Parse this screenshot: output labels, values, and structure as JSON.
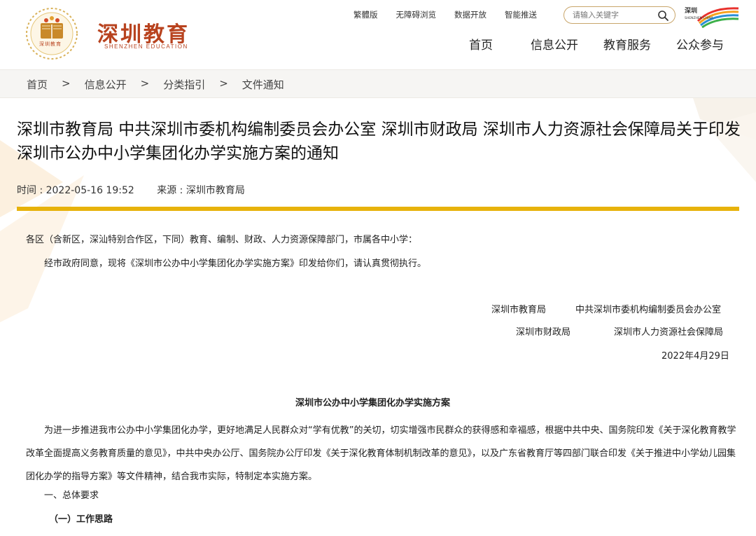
{
  "header": {
    "logo_title": "深圳教育",
    "logo_sub": "SHENZHEN EDUCATION",
    "logo_emblem_text": "深圳教育",
    "util_links": [
      "繁體版",
      "无障碍浏览",
      "数据开放",
      "智能推送"
    ],
    "search_placeholder": "请输入关键字",
    "brand_text": "深圳",
    "brand_sub": "SHENZHEN CHINA",
    "nav": [
      "首页",
      "信息公开",
      "教育服务",
      "公众参与"
    ]
  },
  "breadcrumb": [
    "首页",
    "信息公开",
    "分类指引",
    "文件通知"
  ],
  "breadcrumb_sep": ">",
  "article": {
    "title": "深圳市教育局 中共深圳市委机构编制委员会办公室 深圳市财政局 深圳市人力资源社会保障局关于印发深圳市公办中小学集团化办学实施方案的通知",
    "time": "时间 : 2022-05-16 19:52",
    "source": "来源 : 深圳市教育局",
    "addressee": "各区（含新区，深汕特别合作区，下同）教育、编制、财政、人力资源保障部门，市属各中小学：",
    "intro": "经市政府同意，现将《深圳市公办中小学集团化办学实施方案》印发给你们，请认真贯彻执行。",
    "signers": [
      "深圳市教育局",
      "中共深圳市委机构编制委员会办公室",
      "深圳市财政局",
      "深圳市人力资源社会保障局"
    ],
    "date": "2022年4月29日",
    "doc_title": "深圳市公办中小学集团化办学实施方案",
    "body": "为进一步推进我市公办中小学集团化办学，更好地满足人民群众对“学有优教”的关切，切实增强市民群众的获得感和幸福感，根据中共中央、国务院印发《关于深化教育教学改革全面提高义务教育质量的意见》，中共中央办公厅、国务院办公厅印发《关于深化教育体制机制改革的意见》，以及广东省教育厅等四部门联合印发《关于推进中小学幼儿园集团化办学的指导方案》等文件精神，结合我市实际，特制定本实施方案。",
    "section1": "一、总体要求",
    "section1_1": "（一）工作思路"
  },
  "colors": {
    "accent_gold": "#e7b20b",
    "logo_red": "#b8431f",
    "breadcrumb_bg": "#f6f5f3"
  }
}
